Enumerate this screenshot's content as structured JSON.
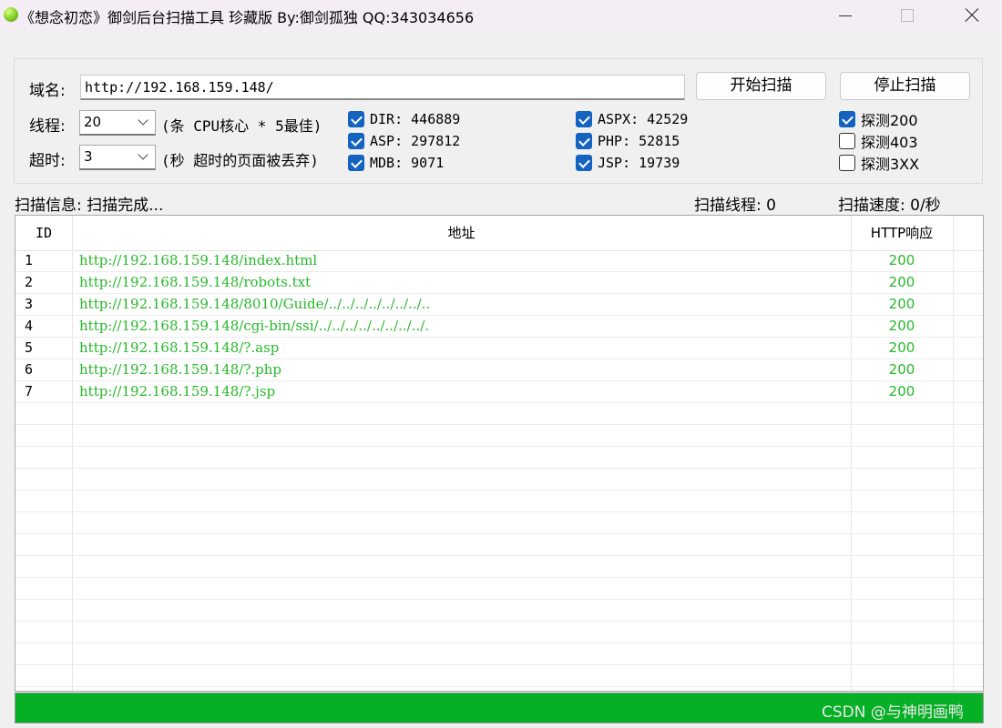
{
  "window": {
    "title": "《想念初恋》御剑后台扫描工具 珍藏版 By:御剑孤独 QQ:343034656"
  },
  "form": {
    "domain_label": "域名:",
    "domain_value": "http://192.168.159.148/",
    "start_button": "开始扫描",
    "stop_button": "停止扫描",
    "threads_label": "线程:",
    "threads_value": "20",
    "threads_hint": "(条 CPU核心 * 5最佳)",
    "timeout_label": "超时:",
    "timeout_value": "3",
    "timeout_hint": "(秒 超时的页面被丢弃)"
  },
  "dictionaries": [
    {
      "label": "DIR: 446889",
      "checked": true
    },
    {
      "label": "ASP: 297812",
      "checked": true
    },
    {
      "label": "MDB: 9071",
      "checked": true
    },
    {
      "label": "ASPX: 42529",
      "checked": true
    },
    {
      "label": "PHP: 52815",
      "checked": true
    },
    {
      "label": "JSP: 19739",
      "checked": true
    }
  ],
  "probes": [
    {
      "label": "探测200",
      "checked": true
    },
    {
      "label": "探测403",
      "checked": false
    },
    {
      "label": "探测3XX",
      "checked": false
    }
  ],
  "status": {
    "info": "扫描信息: 扫描完成...",
    "threads": "扫描线程: 0",
    "speed": "扫描速度: 0/秒"
  },
  "table": {
    "headers": [
      "ID",
      "地址",
      "HTTP响应"
    ],
    "rows": [
      {
        "id": "1",
        "url": "http://192.168.159.148/index.html",
        "code": "200"
      },
      {
        "id": "2",
        "url": "http://192.168.159.148/robots.txt",
        "code": "200"
      },
      {
        "id": "3",
        "url": "http://192.168.159.148/8010/Guide/../../../../../../../..",
        "code": "200"
      },
      {
        "id": "4",
        "url": "http://192.168.159.148/cgi-bin/ssi/../../../../../../../../.",
        "code": "200"
      },
      {
        "id": "5",
        "url": "http://192.168.159.148/?.asp",
        "code": "200"
      },
      {
        "id": "6",
        "url": "http://192.168.159.148/?.php",
        "code": "200"
      },
      {
        "id": "7",
        "url": "http://192.168.159.148/?.jsp",
        "code": "200"
      }
    ]
  },
  "progress": {
    "fraction": 1.0
  },
  "watermark": "CSDN @与神明画鸭",
  "colors": {
    "result_text": "#27b82b",
    "progress_fill": "#06b025",
    "checkbox_on": "#1463c1"
  }
}
